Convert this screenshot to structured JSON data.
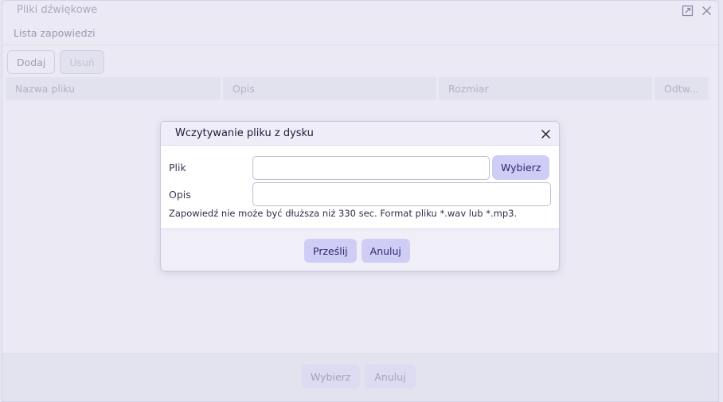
{
  "window": {
    "title": "Pliki dźwiękowe",
    "icons": {
      "popout": "popout-icon",
      "close": "close-icon"
    }
  },
  "subheader": {
    "label": "Lista zapowiedzi"
  },
  "toolbar": {
    "add_label": "Dodaj",
    "remove_label": "Usuń"
  },
  "table": {
    "columns": [
      "Nazwa pliku",
      "Opis",
      "Rozmiar",
      "Odtw..."
    ]
  },
  "footer": {
    "select_label": "Wybierz",
    "cancel_label": "Anuluj"
  },
  "modal": {
    "title": "Wczytywanie pliku z dysku",
    "file_label": "Plik",
    "file_value": "",
    "pick_label": "Wybierz",
    "desc_label": "Opis",
    "desc_value": "",
    "hint": "Zapowiedź nie może być dłuższa niż 330 sec. Format pliku *.wav lub *.mp3.",
    "submit_label": "Prześlij",
    "cancel_label": "Anuluj"
  },
  "colors": {
    "accent_button": "#cfcdf5",
    "accent_text": "#2a2870",
    "background": "#ebeaf4"
  }
}
